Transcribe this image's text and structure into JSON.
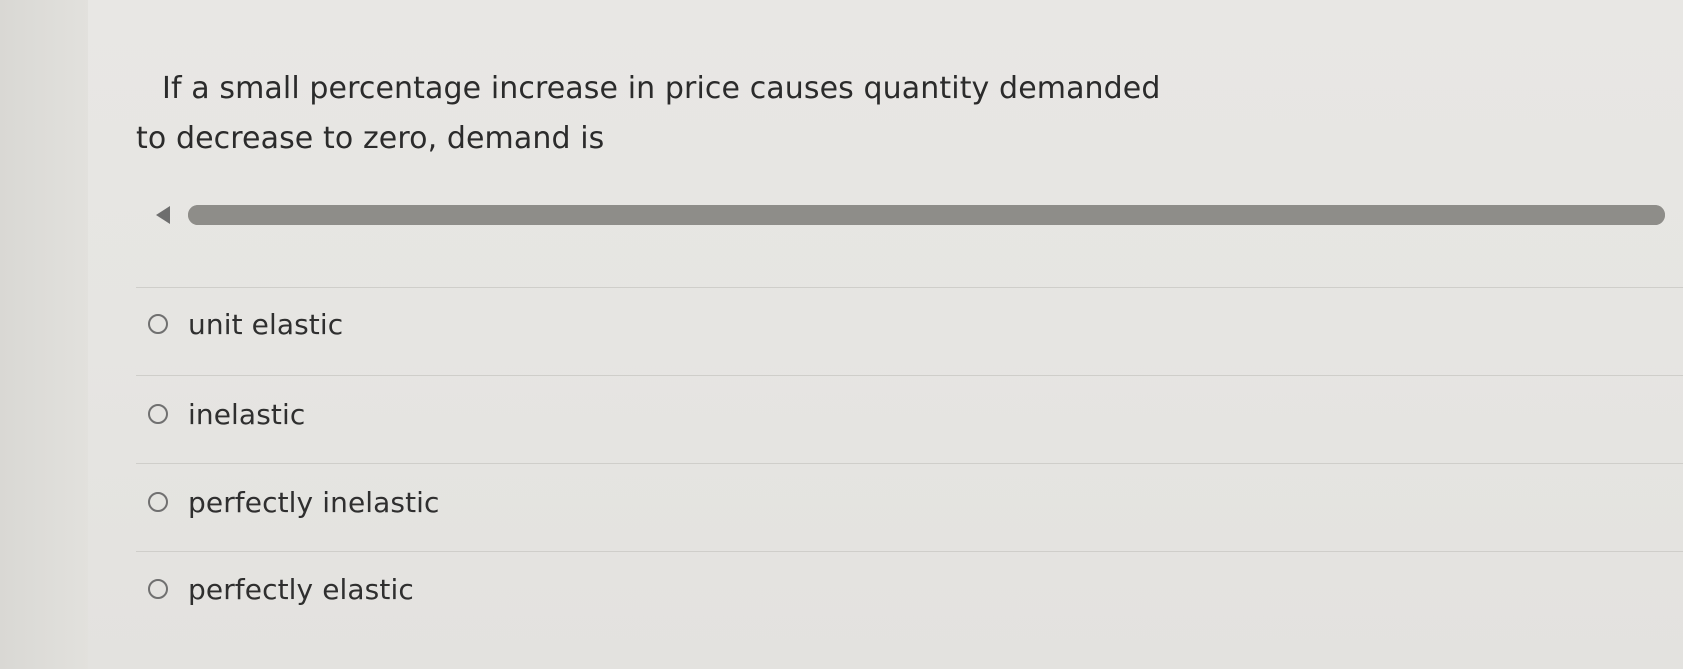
{
  "question": {
    "line1": "If a small percentage increase in price causes quantity demanded",
    "line2": "to decrease to zero, demand is"
  },
  "media": {
    "play_icon": "play-left-icon",
    "progress_fraction": 1.0
  },
  "options": [
    {
      "label": "unit elastic",
      "selected": false
    },
    {
      "label": "inelastic",
      "selected": false
    },
    {
      "label": "perfectly inelastic",
      "selected": false
    },
    {
      "label": "perfectly elastic",
      "selected": false
    }
  ],
  "colors": {
    "background": "#e6e5e2",
    "text": "#2f2f2f",
    "track": "#8e8d89",
    "divider": "#cfceca"
  }
}
